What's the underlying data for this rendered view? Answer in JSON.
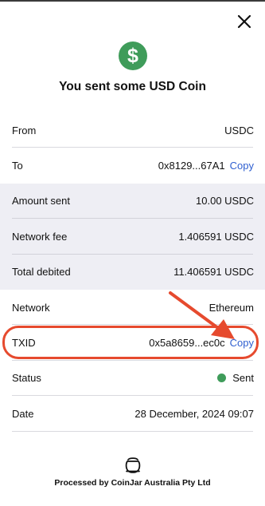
{
  "header": {
    "close_icon": "close-icon",
    "coin_icon": "dollar-icon",
    "coin_symbol": "$",
    "coin_color": "#3f9c5a",
    "title": "You sent some USD Coin"
  },
  "details": {
    "from": {
      "label": "From",
      "value": "USDC"
    },
    "to": {
      "label": "To",
      "value": "0x8129...67A1",
      "copy": "Copy"
    },
    "amount_sent": {
      "label": "Amount sent",
      "value": "10.00 USDC"
    },
    "network_fee": {
      "label": "Network fee",
      "value": "1.406591 USDC"
    },
    "total_debited": {
      "label": "Total debited",
      "value": "11.406591 USDC"
    },
    "network": {
      "label": "Network",
      "value": "Ethereum"
    },
    "txid": {
      "label": "TXID",
      "value": "0x5a8659...ec0c",
      "copy": "Copy"
    },
    "status": {
      "label": "Status",
      "value": "Sent",
      "status_color": "#3f9c5a"
    },
    "date": {
      "label": "Date",
      "value": "28 December, 2024 09:07"
    }
  },
  "annotation": {
    "arrow_color": "#e64a2e",
    "highlight_color": "#e64a2e"
  },
  "footer": {
    "icon": "coinjar-logo-icon",
    "text": "Processed by CoinJar Australia Pty Ltd"
  },
  "colors": {
    "link": "#2f5fd0",
    "shaded_row": "#eeeef4"
  }
}
